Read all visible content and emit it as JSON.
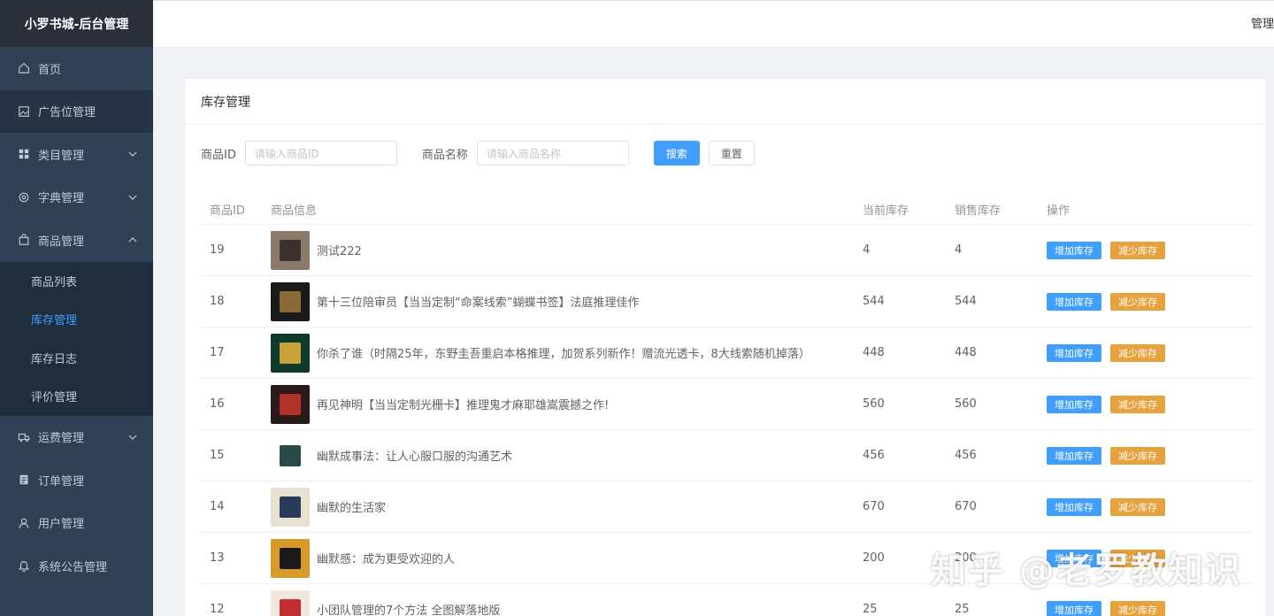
{
  "sidebar": {
    "app_title": "小罗书城-后台管理",
    "items": [
      {
        "label": "首页",
        "icon": "home-icon"
      },
      {
        "label": "广告位管理",
        "icon": "picture-icon"
      },
      {
        "label": "类目管理",
        "icon": "grid-icon"
      },
      {
        "label": "字典管理",
        "icon": "gear-icon"
      },
      {
        "label": "商品管理",
        "icon": "bag-icon"
      },
      {
        "label": "运费管理",
        "icon": "truck-icon"
      },
      {
        "label": "订单管理",
        "icon": "document-icon"
      },
      {
        "label": "用户管理",
        "icon": "user-icon"
      },
      {
        "label": "系统公告管理",
        "icon": "bell-icon"
      }
    ],
    "goods_submenu": [
      {
        "label": "商品列表"
      },
      {
        "label": "库存管理"
      },
      {
        "label": "库存日志"
      },
      {
        "label": "评价管理"
      }
    ]
  },
  "header": {
    "user_label": "管理"
  },
  "card": {
    "title": "库存管理"
  },
  "search": {
    "id_label": "商品ID",
    "id_placeholder": "请输入商品ID",
    "name_label": "商品名称",
    "name_placeholder": "请输入商品名称",
    "search_button": "搜索",
    "reset_button": "重置"
  },
  "table": {
    "columns": [
      "商品ID",
      "商品信息",
      "当前库存",
      "销售库存",
      "操作"
    ],
    "add_label": "增加库存",
    "sub_label": "减少库存",
    "rows": [
      {
        "id": "19",
        "name": "测试222",
        "current": "4",
        "sale": "4",
        "thumb_colors": [
          "#8a7a6a",
          "#3a3030"
        ]
      },
      {
        "id": "18",
        "name": "第十三位陪审员【当当定制“命案线索”蝴蝶书签】法庭推理佳作",
        "current": "544",
        "sale": "544",
        "thumb_colors": [
          "#1a1a1a",
          "#8b6a3a"
        ]
      },
      {
        "id": "17",
        "name": "你杀了谁（时隔25年，东野圭吾重启本格推理，加贺系列新作！赠流光透卡，8大线索随机掉落）",
        "current": "448",
        "sale": "448",
        "thumb_colors": [
          "#0f3a2a",
          "#c9a13a"
        ]
      },
      {
        "id": "16",
        "name": "再见神明【当当定制光栅卡】推理鬼才麻耶雄嵩震撼之作!",
        "current": "560",
        "sale": "560",
        "thumb_colors": [
          "#2a1a1a",
          "#b0302a"
        ]
      },
      {
        "id": "15",
        "name": "幽默成事法：让人心服口服的沟通艺术",
        "current": "456",
        "sale": "456",
        "thumb_colors": [
          "#ffffff",
          "#2a4a4a"
        ]
      },
      {
        "id": "14",
        "name": "幽默的生活家",
        "current": "670",
        "sale": "670",
        "thumb_colors": [
          "#e8e0d0",
          "#2a3a5a"
        ]
      },
      {
        "id": "13",
        "name": "幽默感：成为更受欢迎的人",
        "current": "200",
        "sale": "200",
        "thumb_colors": [
          "#d89a2a",
          "#1a1a1a"
        ]
      },
      {
        "id": "12",
        "name": "小团队管理的7个方法 全图解落地版",
        "current": "25",
        "sale": "25",
        "thumb_colors": [
          "#f0e8e0",
          "#c03030"
        ]
      }
    ]
  },
  "watermark": "知乎 @老罗教知识",
  "colors": {
    "sidebar_bg": "#304156",
    "primary": "#409eff",
    "warning": "#e6a23c"
  }
}
